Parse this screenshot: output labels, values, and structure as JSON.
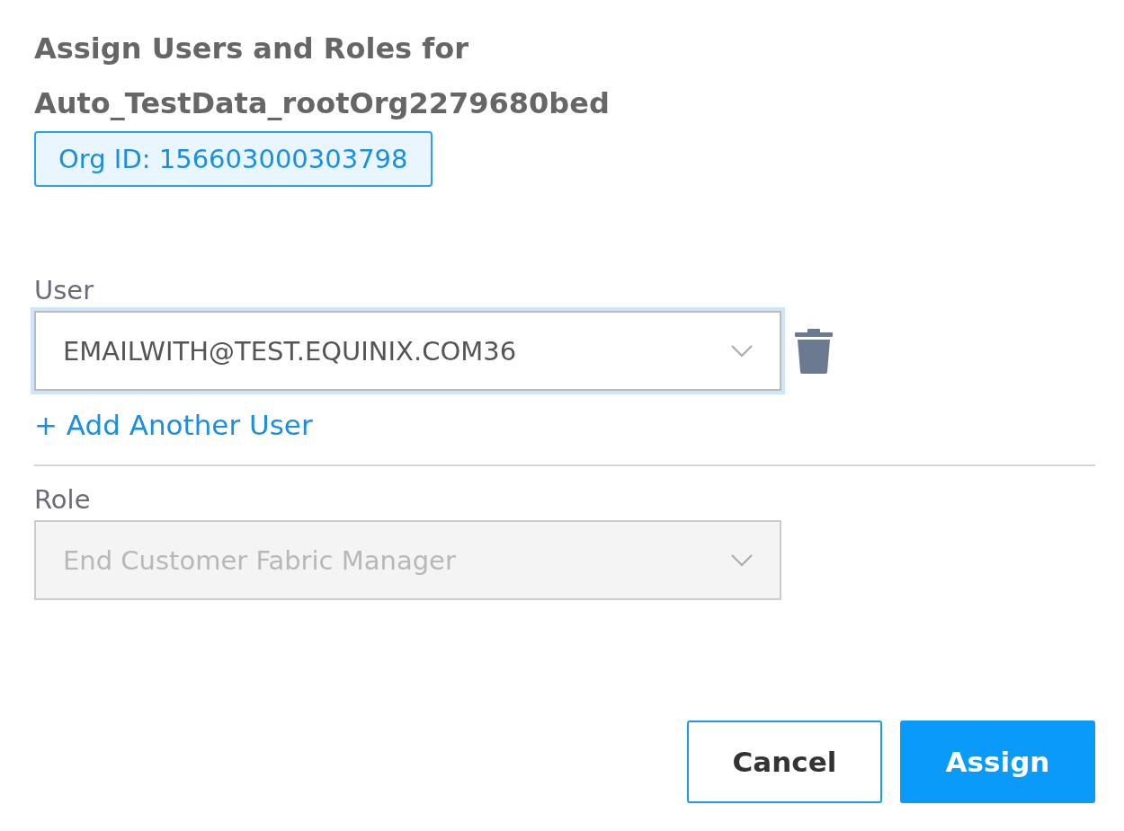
{
  "title": "Assign Users and Roles for Auto_TestData_rootOrg2279680bed",
  "org_badge": "Org ID: 156603000303798",
  "user_field": {
    "label": "User",
    "value": "EMAILWITH@TEST.EQUINIX.COM36",
    "focused": true,
    "disabled": false
  },
  "add_link": "+ Add Another User",
  "role_field": {
    "label": "Role",
    "value": "End Customer Fabric Manager",
    "focused": false,
    "disabled": true
  },
  "buttons": [
    {
      "label": "Cancel",
      "kind": "secondary"
    },
    {
      "label": "Assign",
      "kind": "primary"
    }
  ]
}
